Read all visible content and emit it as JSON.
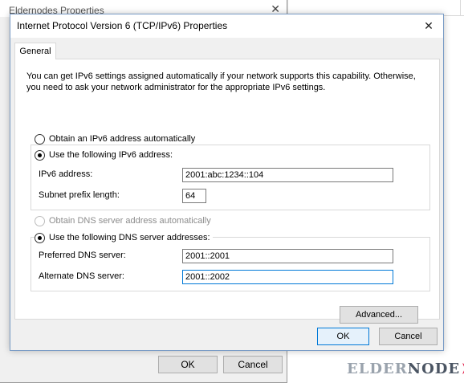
{
  "background_window": {
    "title": "Eldernodes Properties",
    "ok_label": "OK",
    "cancel_label": "Cancel"
  },
  "dialog": {
    "title": "Internet Protocol Version 6 (TCP/IPv6) Properties",
    "close_glyph": "✕",
    "tab_label": "General",
    "description": "You can get IPv6 settings assigned automatically if your network supports this capability. Otherwise, you need to ask your network administrator for the appropriate IPv6 settings.",
    "ip_section": {
      "auto_radio_label": "Obtain an IPv6 address automatically",
      "manual_radio_label": "Use the following IPv6 address:",
      "selected": "manual",
      "ipv6_address_label": "IPv6 address:",
      "ipv6_address_value": "2001:abc:1234::104",
      "subnet_prefix_label": "Subnet prefix length:",
      "subnet_prefix_value": "64"
    },
    "dns_section": {
      "auto_radio_label": "Obtain DNS server address automatically",
      "manual_radio_label": "Use the following DNS server addresses:",
      "selected": "manual",
      "auto_disabled": true,
      "preferred_label": "Preferred DNS server:",
      "preferred_value": "2001::2001",
      "alternate_label": "Alternate DNS server:",
      "alternate_value": "2001::2002"
    },
    "advanced_label": "Advanced...",
    "ok_label": "OK",
    "cancel_label": "Cancel"
  },
  "watermark": {
    "part1": "ELDER",
    "part2": "NODE"
  },
  "colors": {
    "focus_border": "#0078d7",
    "dialog_bg": "#f0f0f0"
  }
}
